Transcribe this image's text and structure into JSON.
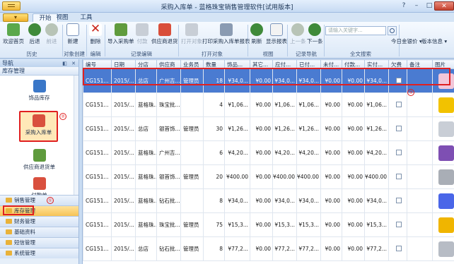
{
  "window": {
    "title": "采购入库单 - 蓝格珠宝销售管理软件[试用版本]",
    "controls": [
      "?",
      "–",
      "□",
      "✕"
    ]
  },
  "ribbon": {
    "tabs": [
      "开始",
      "视图",
      "工具"
    ],
    "active_tab": "开始",
    "buttons": {
      "home": "欢迎首页",
      "back": "后退",
      "forward": "前进",
      "new": "新建",
      "delete": "删除",
      "import_order": "导入采购单",
      "pay": "付款",
      "supplier_return": "供应商退货",
      "open_object": "打开对象",
      "print_report": "打印采购入库单报表",
      "refresh": "刷新",
      "show_report": "显示报表",
      "prev": "上一条",
      "next": "下一条",
      "gold_price": "今日金银价",
      "version": "版本信息"
    },
    "groups": {
      "history": "历史",
      "create": "对象创建",
      "edit": "编辑",
      "record_edit": "记录编辑",
      "open": "打开对象",
      "view": "视图",
      "nav": "记录导航",
      "fulltext": "全文搜索"
    },
    "search_placeholder": "请输入关键字..."
  },
  "nav": {
    "title": "导航",
    "section": "库存管理",
    "items": [
      "饰品库存",
      "采购入库单",
      "供应商退货单",
      "付款单"
    ],
    "modules": [
      "销售管理",
      "库存管理",
      "财务管理",
      "基础资料",
      "短信管理",
      "系统管理"
    ],
    "markers": [
      "①",
      "②",
      "③"
    ]
  },
  "grid": {
    "columns": [
      "编号",
      "日期",
      "分店",
      "供应商",
      "业务员",
      "数量",
      "饰品...",
      "其它...",
      "应付...",
      "已付...",
      "未付...",
      "付款...",
      "实付...",
      "欠费",
      "备注",
      "图片"
    ],
    "rows": [
      [
        "CG151...",
        "2015/...",
        "总店",
        "广州吉...",
        "管理员",
        "18",
        "¥34,0...",
        "¥0.00",
        "¥34,0...",
        "¥34,0...",
        "¥0.00",
        "¥0.00",
        "¥34,0..."
      ],
      [
        "CG151...",
        "2015/...",
        "蓝格珠...",
        "珠宝批...",
        "",
        "4",
        "¥1,06...",
        "¥0.00",
        "¥1,06...",
        "¥1,06...",
        "¥0.00",
        "¥0.00",
        "¥1,06..."
      ],
      [
        "CG151...",
        "2015/...",
        "总店",
        "银首饰...",
        "管理员",
        "30",
        "¥1,26...",
        "¥0.00",
        "¥1,26...",
        "¥1,26...",
        "¥0.00",
        "¥0.00",
        "¥1,26..."
      ],
      [
        "CG151...",
        "2015/...",
        "蓝格珠...",
        "广州吉...",
        "",
        "6",
        "¥4,20...",
        "¥0.00",
        "¥4,20...",
        "¥4,20...",
        "¥0.00",
        "¥0.00",
        "¥4,20..."
      ],
      [
        "CG151...",
        "2015/...",
        "蓝格珠...",
        "银首饰...",
        "管理员",
        "20",
        "¥400.00",
        "¥0.00",
        "¥400.00",
        "¥400.00",
        "¥0.00",
        "¥0.00",
        "¥400.00"
      ],
      [
        "CG151...",
        "2015/...",
        "蓝格珠...",
        "钻石批...",
        "",
        "8",
        "¥34,0...",
        "¥0.00",
        "¥34,0...",
        "¥34,0...",
        "¥0.00",
        "¥0.00",
        "¥34,0..."
      ],
      [
        "CG151...",
        "2015/...",
        "蓝格珠...",
        "珠宝批...",
        "管理员",
        "75",
        "¥15,3...",
        "¥0.00",
        "¥15,3...",
        "¥15,3...",
        "¥0.00",
        "¥0.00",
        "¥15,3..."
      ],
      [
        "CG151...",
        "2015/...",
        "总店",
        "钻石批...",
        "管理员",
        "8",
        "¥77,2...",
        "¥0.00",
        "¥77,2...",
        "¥77,2...",
        "¥0.00",
        "¥0.00",
        "¥77,2..."
      ]
    ],
    "thumb_colors": [
      "#f2c6d8",
      "#f2c200",
      "#c9ced6",
      "#7e4fb3",
      "#a9aeb6",
      "#4a66e8",
      "#f0b500",
      "#b7bcc5"
    ]
  },
  "colors": {
    "accent": "#4a7bd1",
    "highlight": "#e02020",
    "ribbon": "#dbe8f7"
  }
}
